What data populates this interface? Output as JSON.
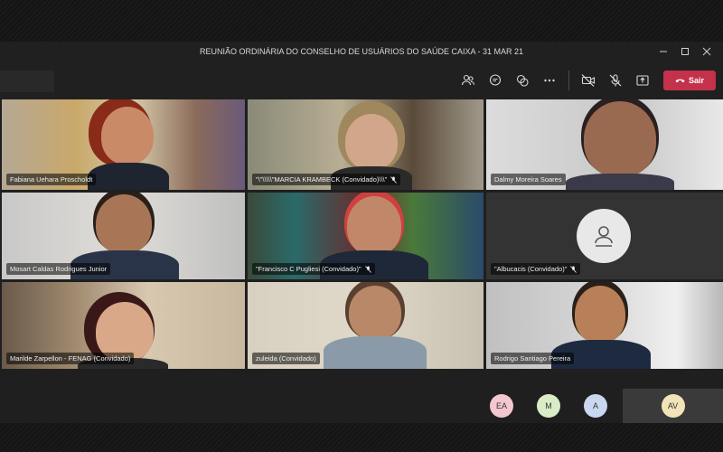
{
  "window": {
    "title": "REUNIÃO ORDINÁRIA DO CONSELHO DE USUÁRIOS DO SAÚDE CAIXA - 31 MAR 21",
    "minimize_icon": "minimize-icon",
    "maximize_icon": "maximize-icon",
    "close_icon": "close-icon"
  },
  "toolbar": {
    "icons": [
      "participants-icon",
      "chat-icon",
      "reactions-icon",
      "more-icon",
      "camera-off-icon",
      "mic-off-icon",
      "share-icon"
    ],
    "leave_label": "Sair",
    "leave_color": "#c4314b"
  },
  "participants": [
    {
      "name": "Fabiana Uehara Proscholdt",
      "muted": false
    },
    {
      "name": "\"\\\"\\\\\\\\\\\"MARCIA KRAMBECK (Convidado)\\\\\\\"",
      "muted": true
    },
    {
      "name": "Dalmy Moreira Soares",
      "muted": false
    },
    {
      "name": "Mosart Caldas Rodrigues Junior",
      "muted": false
    },
    {
      "name": "\"Francisco C Pugliesi (Convidado)\"",
      "muted": true
    },
    {
      "name": "\"Albucacis (Convidado)\"",
      "muted": true
    },
    {
      "name": "Marilde Zarpellon - FENAG (Convidado)",
      "muted": false
    },
    {
      "name": "zuleida (Convidado)",
      "muted": false
    },
    {
      "name": "Rodrigo Santiago Pereira",
      "muted": false
    }
  ],
  "overflow_avatars": [
    {
      "initials": "EA",
      "color": "#f4c7cf"
    },
    {
      "initials": "M",
      "color": "#d9ecc6"
    },
    {
      "initials": "A",
      "color": "#c9d8f0"
    },
    {
      "initials": "AV",
      "color": "#f3e3b8"
    }
  ]
}
